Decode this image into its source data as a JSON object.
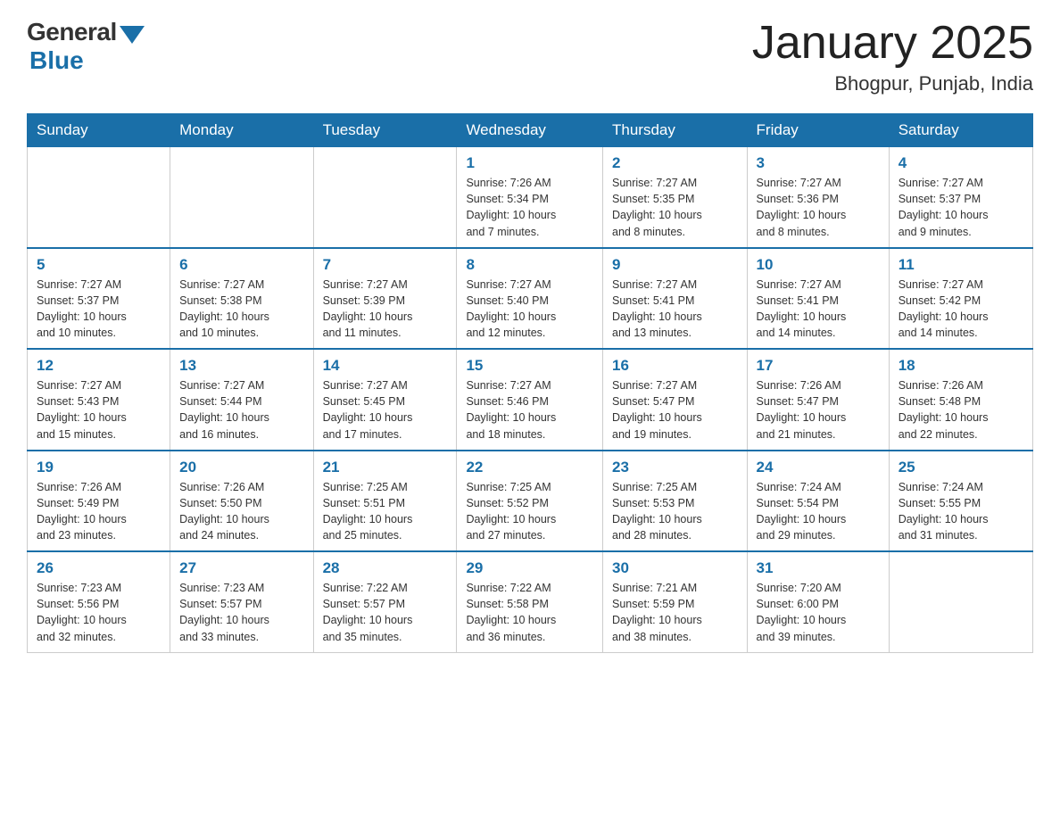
{
  "header": {
    "logo": {
      "general": "General",
      "blue": "Blue"
    },
    "title": "January 2025",
    "location": "Bhogpur, Punjab, India"
  },
  "weekdays": [
    "Sunday",
    "Monday",
    "Tuesday",
    "Wednesday",
    "Thursday",
    "Friday",
    "Saturday"
  ],
  "weeks": [
    [
      {
        "day": "",
        "info": ""
      },
      {
        "day": "",
        "info": ""
      },
      {
        "day": "",
        "info": ""
      },
      {
        "day": "1",
        "info": "Sunrise: 7:26 AM\nSunset: 5:34 PM\nDaylight: 10 hours\nand 7 minutes."
      },
      {
        "day": "2",
        "info": "Sunrise: 7:27 AM\nSunset: 5:35 PM\nDaylight: 10 hours\nand 8 minutes."
      },
      {
        "day": "3",
        "info": "Sunrise: 7:27 AM\nSunset: 5:36 PM\nDaylight: 10 hours\nand 8 minutes."
      },
      {
        "day": "4",
        "info": "Sunrise: 7:27 AM\nSunset: 5:37 PM\nDaylight: 10 hours\nand 9 minutes."
      }
    ],
    [
      {
        "day": "5",
        "info": "Sunrise: 7:27 AM\nSunset: 5:37 PM\nDaylight: 10 hours\nand 10 minutes."
      },
      {
        "day": "6",
        "info": "Sunrise: 7:27 AM\nSunset: 5:38 PM\nDaylight: 10 hours\nand 10 minutes."
      },
      {
        "day": "7",
        "info": "Sunrise: 7:27 AM\nSunset: 5:39 PM\nDaylight: 10 hours\nand 11 minutes."
      },
      {
        "day": "8",
        "info": "Sunrise: 7:27 AM\nSunset: 5:40 PM\nDaylight: 10 hours\nand 12 minutes."
      },
      {
        "day": "9",
        "info": "Sunrise: 7:27 AM\nSunset: 5:41 PM\nDaylight: 10 hours\nand 13 minutes."
      },
      {
        "day": "10",
        "info": "Sunrise: 7:27 AM\nSunset: 5:41 PM\nDaylight: 10 hours\nand 14 minutes."
      },
      {
        "day": "11",
        "info": "Sunrise: 7:27 AM\nSunset: 5:42 PM\nDaylight: 10 hours\nand 14 minutes."
      }
    ],
    [
      {
        "day": "12",
        "info": "Sunrise: 7:27 AM\nSunset: 5:43 PM\nDaylight: 10 hours\nand 15 minutes."
      },
      {
        "day": "13",
        "info": "Sunrise: 7:27 AM\nSunset: 5:44 PM\nDaylight: 10 hours\nand 16 minutes."
      },
      {
        "day": "14",
        "info": "Sunrise: 7:27 AM\nSunset: 5:45 PM\nDaylight: 10 hours\nand 17 minutes."
      },
      {
        "day": "15",
        "info": "Sunrise: 7:27 AM\nSunset: 5:46 PM\nDaylight: 10 hours\nand 18 minutes."
      },
      {
        "day": "16",
        "info": "Sunrise: 7:27 AM\nSunset: 5:47 PM\nDaylight: 10 hours\nand 19 minutes."
      },
      {
        "day": "17",
        "info": "Sunrise: 7:26 AM\nSunset: 5:47 PM\nDaylight: 10 hours\nand 21 minutes."
      },
      {
        "day": "18",
        "info": "Sunrise: 7:26 AM\nSunset: 5:48 PM\nDaylight: 10 hours\nand 22 minutes."
      }
    ],
    [
      {
        "day": "19",
        "info": "Sunrise: 7:26 AM\nSunset: 5:49 PM\nDaylight: 10 hours\nand 23 minutes."
      },
      {
        "day": "20",
        "info": "Sunrise: 7:26 AM\nSunset: 5:50 PM\nDaylight: 10 hours\nand 24 minutes."
      },
      {
        "day": "21",
        "info": "Sunrise: 7:25 AM\nSunset: 5:51 PM\nDaylight: 10 hours\nand 25 minutes."
      },
      {
        "day": "22",
        "info": "Sunrise: 7:25 AM\nSunset: 5:52 PM\nDaylight: 10 hours\nand 27 minutes."
      },
      {
        "day": "23",
        "info": "Sunrise: 7:25 AM\nSunset: 5:53 PM\nDaylight: 10 hours\nand 28 minutes."
      },
      {
        "day": "24",
        "info": "Sunrise: 7:24 AM\nSunset: 5:54 PM\nDaylight: 10 hours\nand 29 minutes."
      },
      {
        "day": "25",
        "info": "Sunrise: 7:24 AM\nSunset: 5:55 PM\nDaylight: 10 hours\nand 31 minutes."
      }
    ],
    [
      {
        "day": "26",
        "info": "Sunrise: 7:23 AM\nSunset: 5:56 PM\nDaylight: 10 hours\nand 32 minutes."
      },
      {
        "day": "27",
        "info": "Sunrise: 7:23 AM\nSunset: 5:57 PM\nDaylight: 10 hours\nand 33 minutes."
      },
      {
        "day": "28",
        "info": "Sunrise: 7:22 AM\nSunset: 5:57 PM\nDaylight: 10 hours\nand 35 minutes."
      },
      {
        "day": "29",
        "info": "Sunrise: 7:22 AM\nSunset: 5:58 PM\nDaylight: 10 hours\nand 36 minutes."
      },
      {
        "day": "30",
        "info": "Sunrise: 7:21 AM\nSunset: 5:59 PM\nDaylight: 10 hours\nand 38 minutes."
      },
      {
        "day": "31",
        "info": "Sunrise: 7:20 AM\nSunset: 6:00 PM\nDaylight: 10 hours\nand 39 minutes."
      },
      {
        "day": "",
        "info": ""
      }
    ]
  ]
}
